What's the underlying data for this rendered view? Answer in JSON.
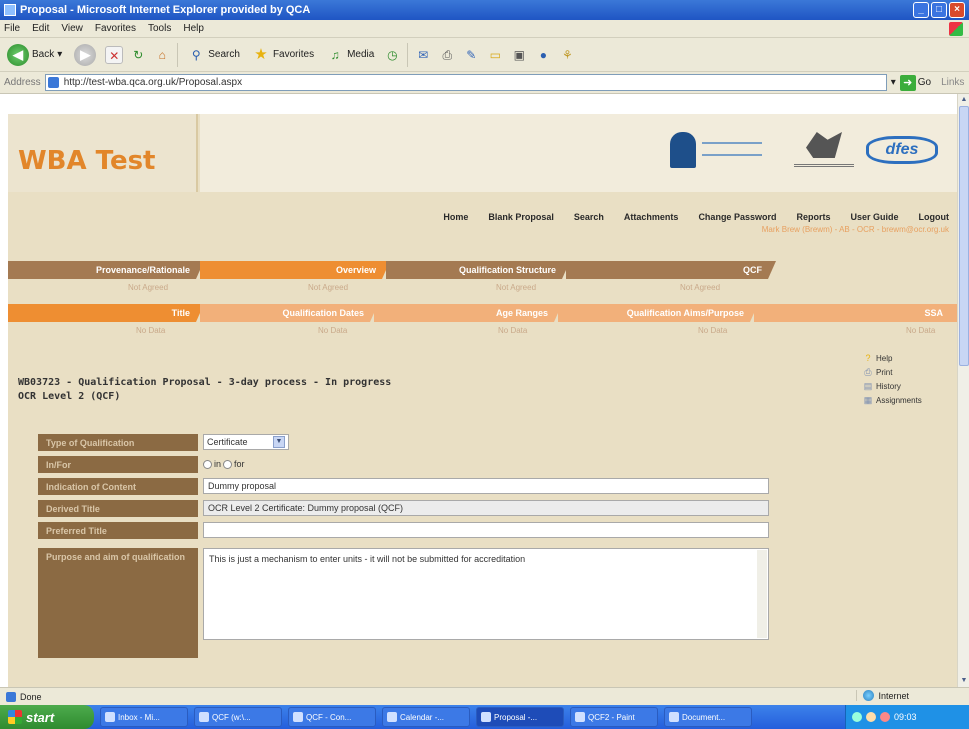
{
  "window": {
    "title": "Proposal - Microsoft Internet Explorer provided by QCA",
    "min": "_",
    "max": "□",
    "close": "×"
  },
  "menu": [
    "File",
    "Edit",
    "View",
    "Favorites",
    "Tools",
    "Help"
  ],
  "toolbar": {
    "back": "Back",
    "search": "Search",
    "favorites": "Favorites",
    "media": "Media"
  },
  "address": {
    "label": "Address",
    "url": "http://test-wba.qca.org.uk/Proposal.aspx",
    "go": "Go",
    "links": "Links"
  },
  "site": {
    "brand": "WBA Test",
    "nav": [
      "Home",
      "Blank Proposal",
      "Search",
      "Attachments",
      "Change Password",
      "Reports",
      "User Guide",
      "Logout"
    ],
    "user_info": "Mark Brew (Brewm) - AB - OCR - brewm@ocr.org.uk"
  },
  "tabs_row1": [
    {
      "label": "Provenance/Rationale",
      "sub": "Not Agreed"
    },
    {
      "label": "Overview",
      "sub": "Not Agreed"
    },
    {
      "label": "Qualification Structure",
      "sub": "Not Agreed"
    },
    {
      "label": "QCF",
      "sub": "Not Agreed"
    }
  ],
  "tabs_row2": [
    {
      "label": "Title",
      "sub": "No Data"
    },
    {
      "label": "Qualification Dates",
      "sub": "No Data"
    },
    {
      "label": "Age Ranges",
      "sub": "No Data"
    },
    {
      "label": "Qualification Aims/Purpose",
      "sub": "No Data"
    },
    {
      "label": "SSA",
      "sub": "No Data"
    }
  ],
  "record": {
    "title": "WB03723 - Qualification Proposal - 3-day process - In progress",
    "subtitle": "OCR Level 2 (QCF)"
  },
  "sidebar": [
    "Help",
    "Print",
    "History",
    "Assignments"
  ],
  "form": {
    "type_label": "Type of Qualification",
    "type_value": "Certificate",
    "infor_label": "In/For",
    "radio_in": "in",
    "radio_for": "for",
    "content_label": "Indication of Content",
    "content_value": "Dummy proposal",
    "derived_label": "Derived Title",
    "derived_value": "OCR Level 2 Certificate: Dummy proposal (QCF)",
    "preferred_label": "Preferred Title",
    "preferred_value": "",
    "purpose_label": "Purpose and aim of qualification",
    "purpose_value": "This is just a mechanism to enter units - it will not be submitted for accreditation"
  },
  "status": {
    "left": "Done",
    "zone": "Internet"
  },
  "taskbar": {
    "start": "start",
    "tasks": [
      "Inbox - Mi...",
      "QCF (w:\\...",
      "QCF - Con...",
      "Calendar -...",
      "Proposal -...",
      "QCF2 - Paint",
      "Document..."
    ],
    "time": "09:03"
  },
  "colors": {
    "brand": "#e2862a",
    "tab_brown": "#a47a52",
    "tab_orange": "#ee8e32",
    "tab_light": "#f2b07a",
    "label_brown": "#8b6a43"
  }
}
